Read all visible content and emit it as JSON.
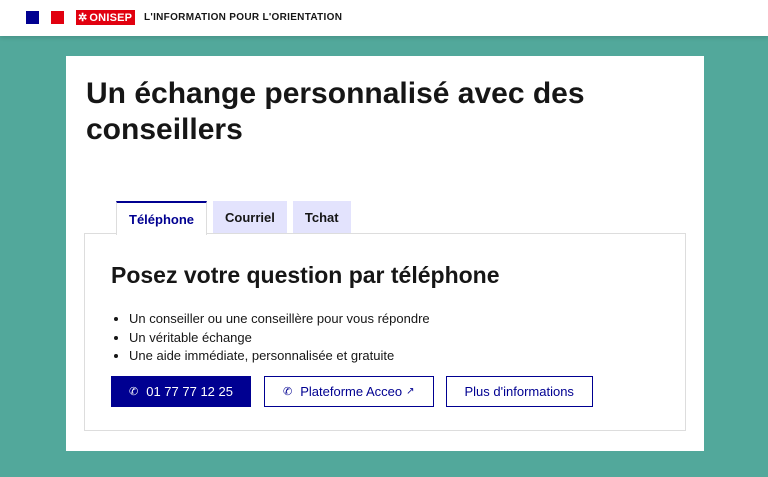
{
  "header": {
    "logo_text": "ONISEP",
    "tagline": "L'INFORMATION POUR L'ORIENTATION",
    "flag_colors": [
      "#000091",
      "#ffffff",
      "#e1000f"
    ]
  },
  "main": {
    "title": "Un échange personnalisé avec des conseillers",
    "tabs": [
      {
        "label": "Téléphone",
        "active": true
      },
      {
        "label": "Courriel",
        "active": false
      },
      {
        "label": "Tchat",
        "active": false
      }
    ],
    "panel": {
      "title": "Posez votre question par téléphone",
      "features": [
        "Un conseiller ou une conseillère pour vous répondre",
        "Un véritable échange",
        "Une aide immédiate, personnalisée et gratuite"
      ],
      "buttons": {
        "phone": {
          "label": "01 77 77 12 25",
          "icon": "phone-icon"
        },
        "acceo": {
          "label": "Plateforme Acceo",
          "icon": "phone-icon",
          "trailing_icon": "external-link-icon"
        },
        "info": {
          "label": "Plus d'informations"
        }
      }
    }
  },
  "colors": {
    "background": "#52a89b",
    "accent": "#000091",
    "tab_inactive": "#e3e3fd",
    "brand_red": "#e1000f"
  }
}
